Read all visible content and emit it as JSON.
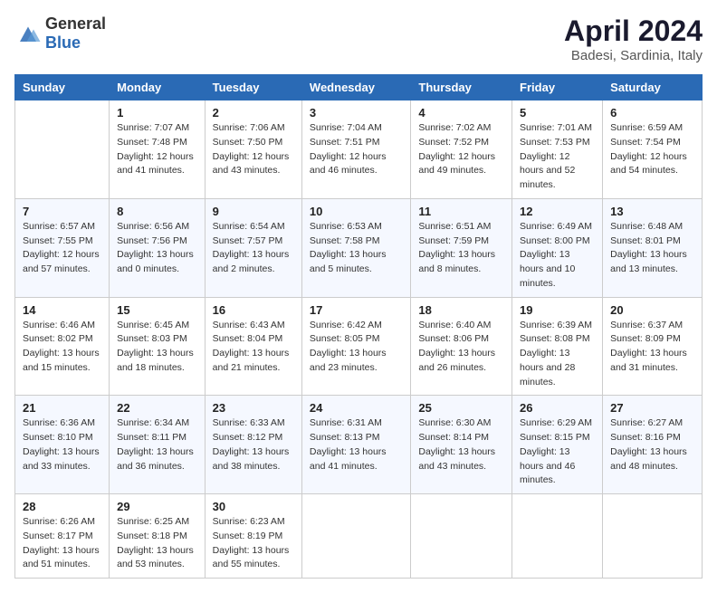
{
  "header": {
    "logo_general": "General",
    "logo_blue": "Blue",
    "title": "April 2024",
    "subtitle": "Badesi, Sardinia, Italy"
  },
  "columns": [
    "Sunday",
    "Monday",
    "Tuesday",
    "Wednesday",
    "Thursday",
    "Friday",
    "Saturday"
  ],
  "rows": [
    [
      {
        "day": "",
        "sunrise": "",
        "sunset": "",
        "daylight": ""
      },
      {
        "day": "1",
        "sunrise": "Sunrise: 7:07 AM",
        "sunset": "Sunset: 7:48 PM",
        "daylight": "Daylight: 12 hours and 41 minutes."
      },
      {
        "day": "2",
        "sunrise": "Sunrise: 7:06 AM",
        "sunset": "Sunset: 7:50 PM",
        "daylight": "Daylight: 12 hours and 43 minutes."
      },
      {
        "day": "3",
        "sunrise": "Sunrise: 7:04 AM",
        "sunset": "Sunset: 7:51 PM",
        "daylight": "Daylight: 12 hours and 46 minutes."
      },
      {
        "day": "4",
        "sunrise": "Sunrise: 7:02 AM",
        "sunset": "Sunset: 7:52 PM",
        "daylight": "Daylight: 12 hours and 49 minutes."
      },
      {
        "day": "5",
        "sunrise": "Sunrise: 7:01 AM",
        "sunset": "Sunset: 7:53 PM",
        "daylight": "Daylight: 12 hours and 52 minutes."
      },
      {
        "day": "6",
        "sunrise": "Sunrise: 6:59 AM",
        "sunset": "Sunset: 7:54 PM",
        "daylight": "Daylight: 12 hours and 54 minutes."
      }
    ],
    [
      {
        "day": "7",
        "sunrise": "Sunrise: 6:57 AM",
        "sunset": "Sunset: 7:55 PM",
        "daylight": "Daylight: 12 hours and 57 minutes."
      },
      {
        "day": "8",
        "sunrise": "Sunrise: 6:56 AM",
        "sunset": "Sunset: 7:56 PM",
        "daylight": "Daylight: 13 hours and 0 minutes."
      },
      {
        "day": "9",
        "sunrise": "Sunrise: 6:54 AM",
        "sunset": "Sunset: 7:57 PM",
        "daylight": "Daylight: 13 hours and 2 minutes."
      },
      {
        "day": "10",
        "sunrise": "Sunrise: 6:53 AM",
        "sunset": "Sunset: 7:58 PM",
        "daylight": "Daylight: 13 hours and 5 minutes."
      },
      {
        "day": "11",
        "sunrise": "Sunrise: 6:51 AM",
        "sunset": "Sunset: 7:59 PM",
        "daylight": "Daylight: 13 hours and 8 minutes."
      },
      {
        "day": "12",
        "sunrise": "Sunrise: 6:49 AM",
        "sunset": "Sunset: 8:00 PM",
        "daylight": "Daylight: 13 hours and 10 minutes."
      },
      {
        "day": "13",
        "sunrise": "Sunrise: 6:48 AM",
        "sunset": "Sunset: 8:01 PM",
        "daylight": "Daylight: 13 hours and 13 minutes."
      }
    ],
    [
      {
        "day": "14",
        "sunrise": "Sunrise: 6:46 AM",
        "sunset": "Sunset: 8:02 PM",
        "daylight": "Daylight: 13 hours and 15 minutes."
      },
      {
        "day": "15",
        "sunrise": "Sunrise: 6:45 AM",
        "sunset": "Sunset: 8:03 PM",
        "daylight": "Daylight: 13 hours and 18 minutes."
      },
      {
        "day": "16",
        "sunrise": "Sunrise: 6:43 AM",
        "sunset": "Sunset: 8:04 PM",
        "daylight": "Daylight: 13 hours and 21 minutes."
      },
      {
        "day": "17",
        "sunrise": "Sunrise: 6:42 AM",
        "sunset": "Sunset: 8:05 PM",
        "daylight": "Daylight: 13 hours and 23 minutes."
      },
      {
        "day": "18",
        "sunrise": "Sunrise: 6:40 AM",
        "sunset": "Sunset: 8:06 PM",
        "daylight": "Daylight: 13 hours and 26 minutes."
      },
      {
        "day": "19",
        "sunrise": "Sunrise: 6:39 AM",
        "sunset": "Sunset: 8:08 PM",
        "daylight": "Daylight: 13 hours and 28 minutes."
      },
      {
        "day": "20",
        "sunrise": "Sunrise: 6:37 AM",
        "sunset": "Sunset: 8:09 PM",
        "daylight": "Daylight: 13 hours and 31 minutes."
      }
    ],
    [
      {
        "day": "21",
        "sunrise": "Sunrise: 6:36 AM",
        "sunset": "Sunset: 8:10 PM",
        "daylight": "Daylight: 13 hours and 33 minutes."
      },
      {
        "day": "22",
        "sunrise": "Sunrise: 6:34 AM",
        "sunset": "Sunset: 8:11 PM",
        "daylight": "Daylight: 13 hours and 36 minutes."
      },
      {
        "day": "23",
        "sunrise": "Sunrise: 6:33 AM",
        "sunset": "Sunset: 8:12 PM",
        "daylight": "Daylight: 13 hours and 38 minutes."
      },
      {
        "day": "24",
        "sunrise": "Sunrise: 6:31 AM",
        "sunset": "Sunset: 8:13 PM",
        "daylight": "Daylight: 13 hours and 41 minutes."
      },
      {
        "day": "25",
        "sunrise": "Sunrise: 6:30 AM",
        "sunset": "Sunset: 8:14 PM",
        "daylight": "Daylight: 13 hours and 43 minutes."
      },
      {
        "day": "26",
        "sunrise": "Sunrise: 6:29 AM",
        "sunset": "Sunset: 8:15 PM",
        "daylight": "Daylight: 13 hours and 46 minutes."
      },
      {
        "day": "27",
        "sunrise": "Sunrise: 6:27 AM",
        "sunset": "Sunset: 8:16 PM",
        "daylight": "Daylight: 13 hours and 48 minutes."
      }
    ],
    [
      {
        "day": "28",
        "sunrise": "Sunrise: 6:26 AM",
        "sunset": "Sunset: 8:17 PM",
        "daylight": "Daylight: 13 hours and 51 minutes."
      },
      {
        "day": "29",
        "sunrise": "Sunrise: 6:25 AM",
        "sunset": "Sunset: 8:18 PM",
        "daylight": "Daylight: 13 hours and 53 minutes."
      },
      {
        "day": "30",
        "sunrise": "Sunrise: 6:23 AM",
        "sunset": "Sunset: 8:19 PM",
        "daylight": "Daylight: 13 hours and 55 minutes."
      },
      {
        "day": "",
        "sunrise": "",
        "sunset": "",
        "daylight": ""
      },
      {
        "day": "",
        "sunrise": "",
        "sunset": "",
        "daylight": ""
      },
      {
        "day": "",
        "sunrise": "",
        "sunset": "",
        "daylight": ""
      },
      {
        "day": "",
        "sunrise": "",
        "sunset": "",
        "daylight": ""
      }
    ]
  ]
}
